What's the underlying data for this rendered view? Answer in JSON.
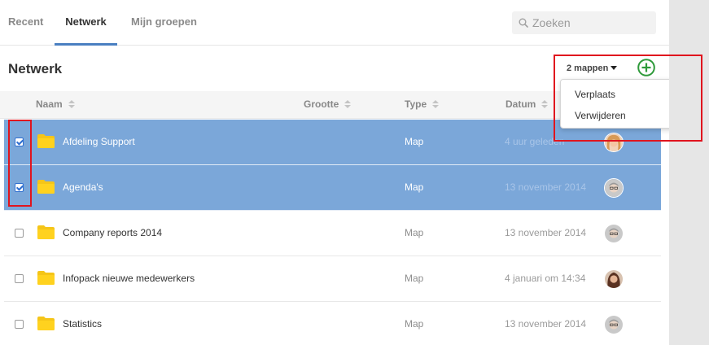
{
  "tabs": [
    {
      "label": "Recent",
      "active": false
    },
    {
      "label": "Netwerk",
      "active": true
    },
    {
      "label": "Mijn groepen",
      "active": false
    }
  ],
  "search": {
    "placeholder": "Zoeken",
    "icon": "search-icon"
  },
  "page_title": "Netwerk",
  "selection": {
    "label": "2 mappen",
    "icon": "caret-down-icon"
  },
  "add_button": {
    "icon": "plus-circle-icon",
    "color": "#2e9a3a"
  },
  "dropdown": {
    "items": [
      "Verplaats",
      "Verwijderen"
    ]
  },
  "table": {
    "columns": [
      "Naam",
      "Grootte",
      "Type",
      "Datum"
    ],
    "rows": [
      {
        "name": "Afdeling Support",
        "type": "Map",
        "date": "4 uur geleden",
        "selected": true,
        "avatar": "avatar-woman-blonde"
      },
      {
        "name": "Agenda's",
        "type": "Map",
        "date": "13 november 2014",
        "selected": true,
        "avatar": "avatar-man-glasses"
      },
      {
        "name": "Company reports 2014",
        "type": "Map",
        "date": "13 november 2014",
        "selected": false,
        "avatar": "avatar-man-glasses"
      },
      {
        "name": "Infopack nieuwe medewerkers",
        "type": "Map",
        "date": "4 januari om 14:34",
        "selected": false,
        "avatar": "avatar-woman-dark"
      },
      {
        "name": "Statistics",
        "type": "Map",
        "date": "13 november 2014",
        "selected": false,
        "avatar": "avatar-man-glasses"
      }
    ]
  },
  "colors": {
    "accent": "#4a7fc1",
    "selected_row": "#7ba7d9",
    "folder": "#f5c518",
    "highlight": "#e0141e"
  }
}
